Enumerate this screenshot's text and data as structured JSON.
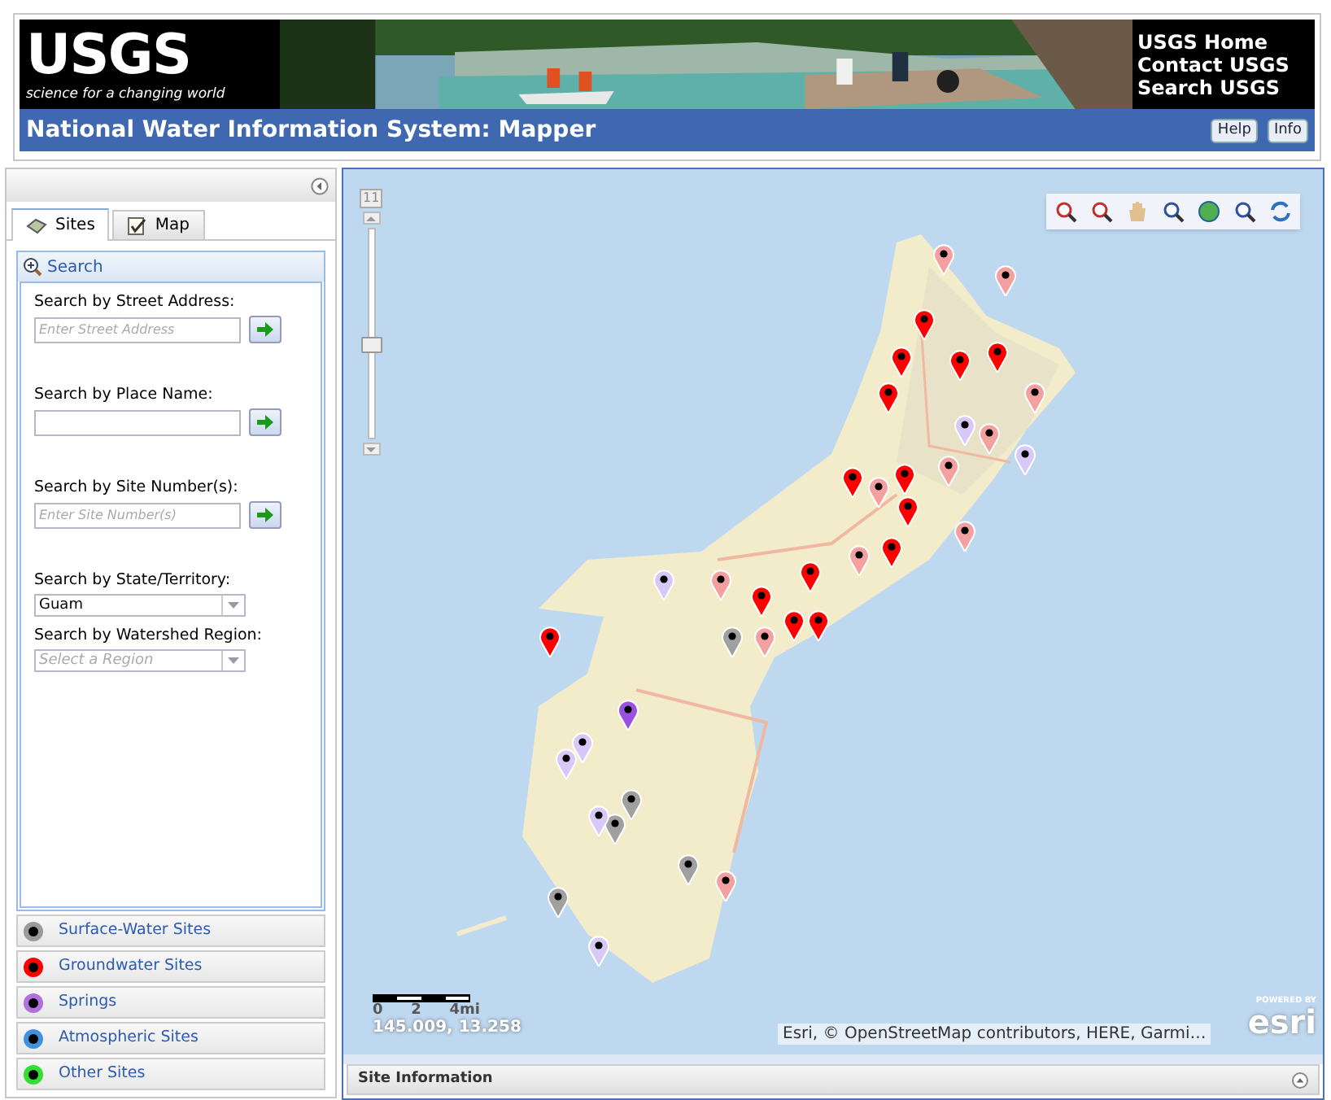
{
  "header": {
    "logo": {
      "wordmark": "USGS",
      "tagline": "science for a changing world"
    },
    "links": [
      {
        "label": "USGS Home"
      },
      {
        "label": "Contact USGS"
      },
      {
        "label": "Search USGS"
      }
    ],
    "title": "National Water Information System: Mapper",
    "buttons": [
      {
        "label": "Help"
      },
      {
        "label": "Info"
      }
    ]
  },
  "sidebar": {
    "tabs": [
      {
        "label": "Sites",
        "selected": true
      },
      {
        "label": "Map",
        "selected": false
      }
    ],
    "search_panel": {
      "title": "Search",
      "fields": [
        {
          "kind": "text",
          "label": "Search by Street Address:",
          "placeholder": "Enter Street Address"
        },
        {
          "kind": "text",
          "label": "Search by Place Name:"
        },
        {
          "kind": "text",
          "label": "Search by Site Number(s):",
          "placeholder": "Enter Site Number(s)"
        },
        {
          "kind": "select",
          "label": "Search by State/Territory:",
          "value": "Guam"
        },
        {
          "kind": "select",
          "label": "Search by Watershed Region:",
          "placeholder": "Select a Region"
        }
      ]
    },
    "site_types": [
      {
        "label": "Surface-Water Sites",
        "color": "#9a9a9a"
      },
      {
        "label": "Groundwater Sites",
        "color": "#ff0000"
      },
      {
        "label": "Springs",
        "color": "#b070e0"
      },
      {
        "label": "Atmospheric Sites",
        "color": "#4090e0"
      },
      {
        "label": "Other Sites",
        "color": "#30e030"
      }
    ]
  },
  "map": {
    "zoom_slider": {
      "label": "11",
      "level": 0.43
    },
    "scale_bar": {
      "ticks": [
        "0",
        "2",
        "4mi"
      ]
    },
    "coordinates": "145.009, 13.258",
    "attribution": "Esri, © OpenStreetMap contributors, HERE, Garmi…",
    "logo": {
      "caption": "POWERED BY",
      "wordmark": "esri"
    }
  },
  "site_information": {
    "title": "Site Information"
  }
}
